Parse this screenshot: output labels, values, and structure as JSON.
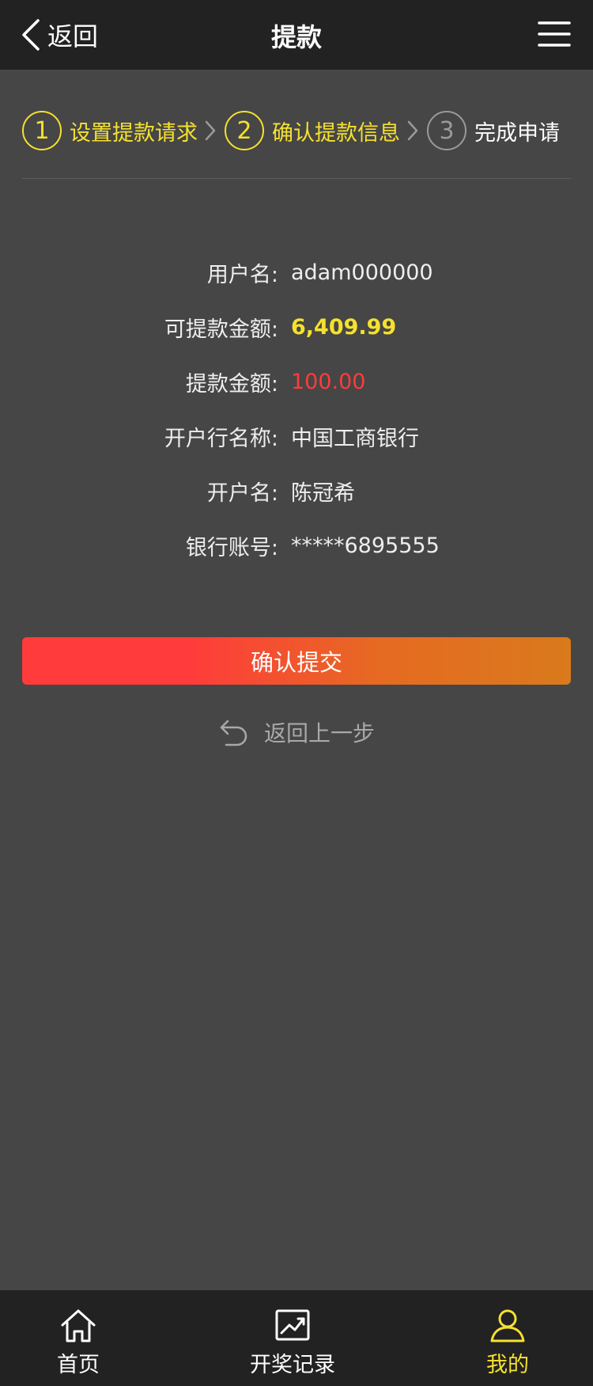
{
  "header": {
    "back_label": "返回",
    "title": "提款",
    "menu_icon": "menu-icon"
  },
  "steps": [
    {
      "number": "1",
      "label": "设置提款请求",
      "state": "done"
    },
    {
      "number": "2",
      "label": "确认提款信息",
      "state": "current"
    },
    {
      "number": "3",
      "label": "完成申请",
      "state": "pending"
    }
  ],
  "info": {
    "username": {
      "label": "用户名:",
      "value": "adam000000"
    },
    "available": {
      "label": "可提款金额:",
      "value": "6,409.99"
    },
    "amount": {
      "label": "提款金额:",
      "value": "100.00"
    },
    "bank_name": {
      "label": "开户行名称:",
      "value": "中国工商银行"
    },
    "account_holder": {
      "label": "开户名:",
      "value": "陈冠希"
    },
    "account_number": {
      "label": "银行账号:",
      "value": "*****6895555"
    }
  },
  "actions": {
    "confirm_label": "确认提交",
    "back_step_label": "返回上一步"
  },
  "tabbar": {
    "items": [
      {
        "label": "首页",
        "icon": "home-icon"
      },
      {
        "label": "开奖记录",
        "icon": "chart-icon"
      },
      {
        "label": "我的",
        "icon": "user-icon",
        "active": true
      }
    ]
  },
  "colors": {
    "accent": "#f5e12e",
    "danger": "#ff3b3b",
    "background": "#464646",
    "bar": "#222222"
  }
}
